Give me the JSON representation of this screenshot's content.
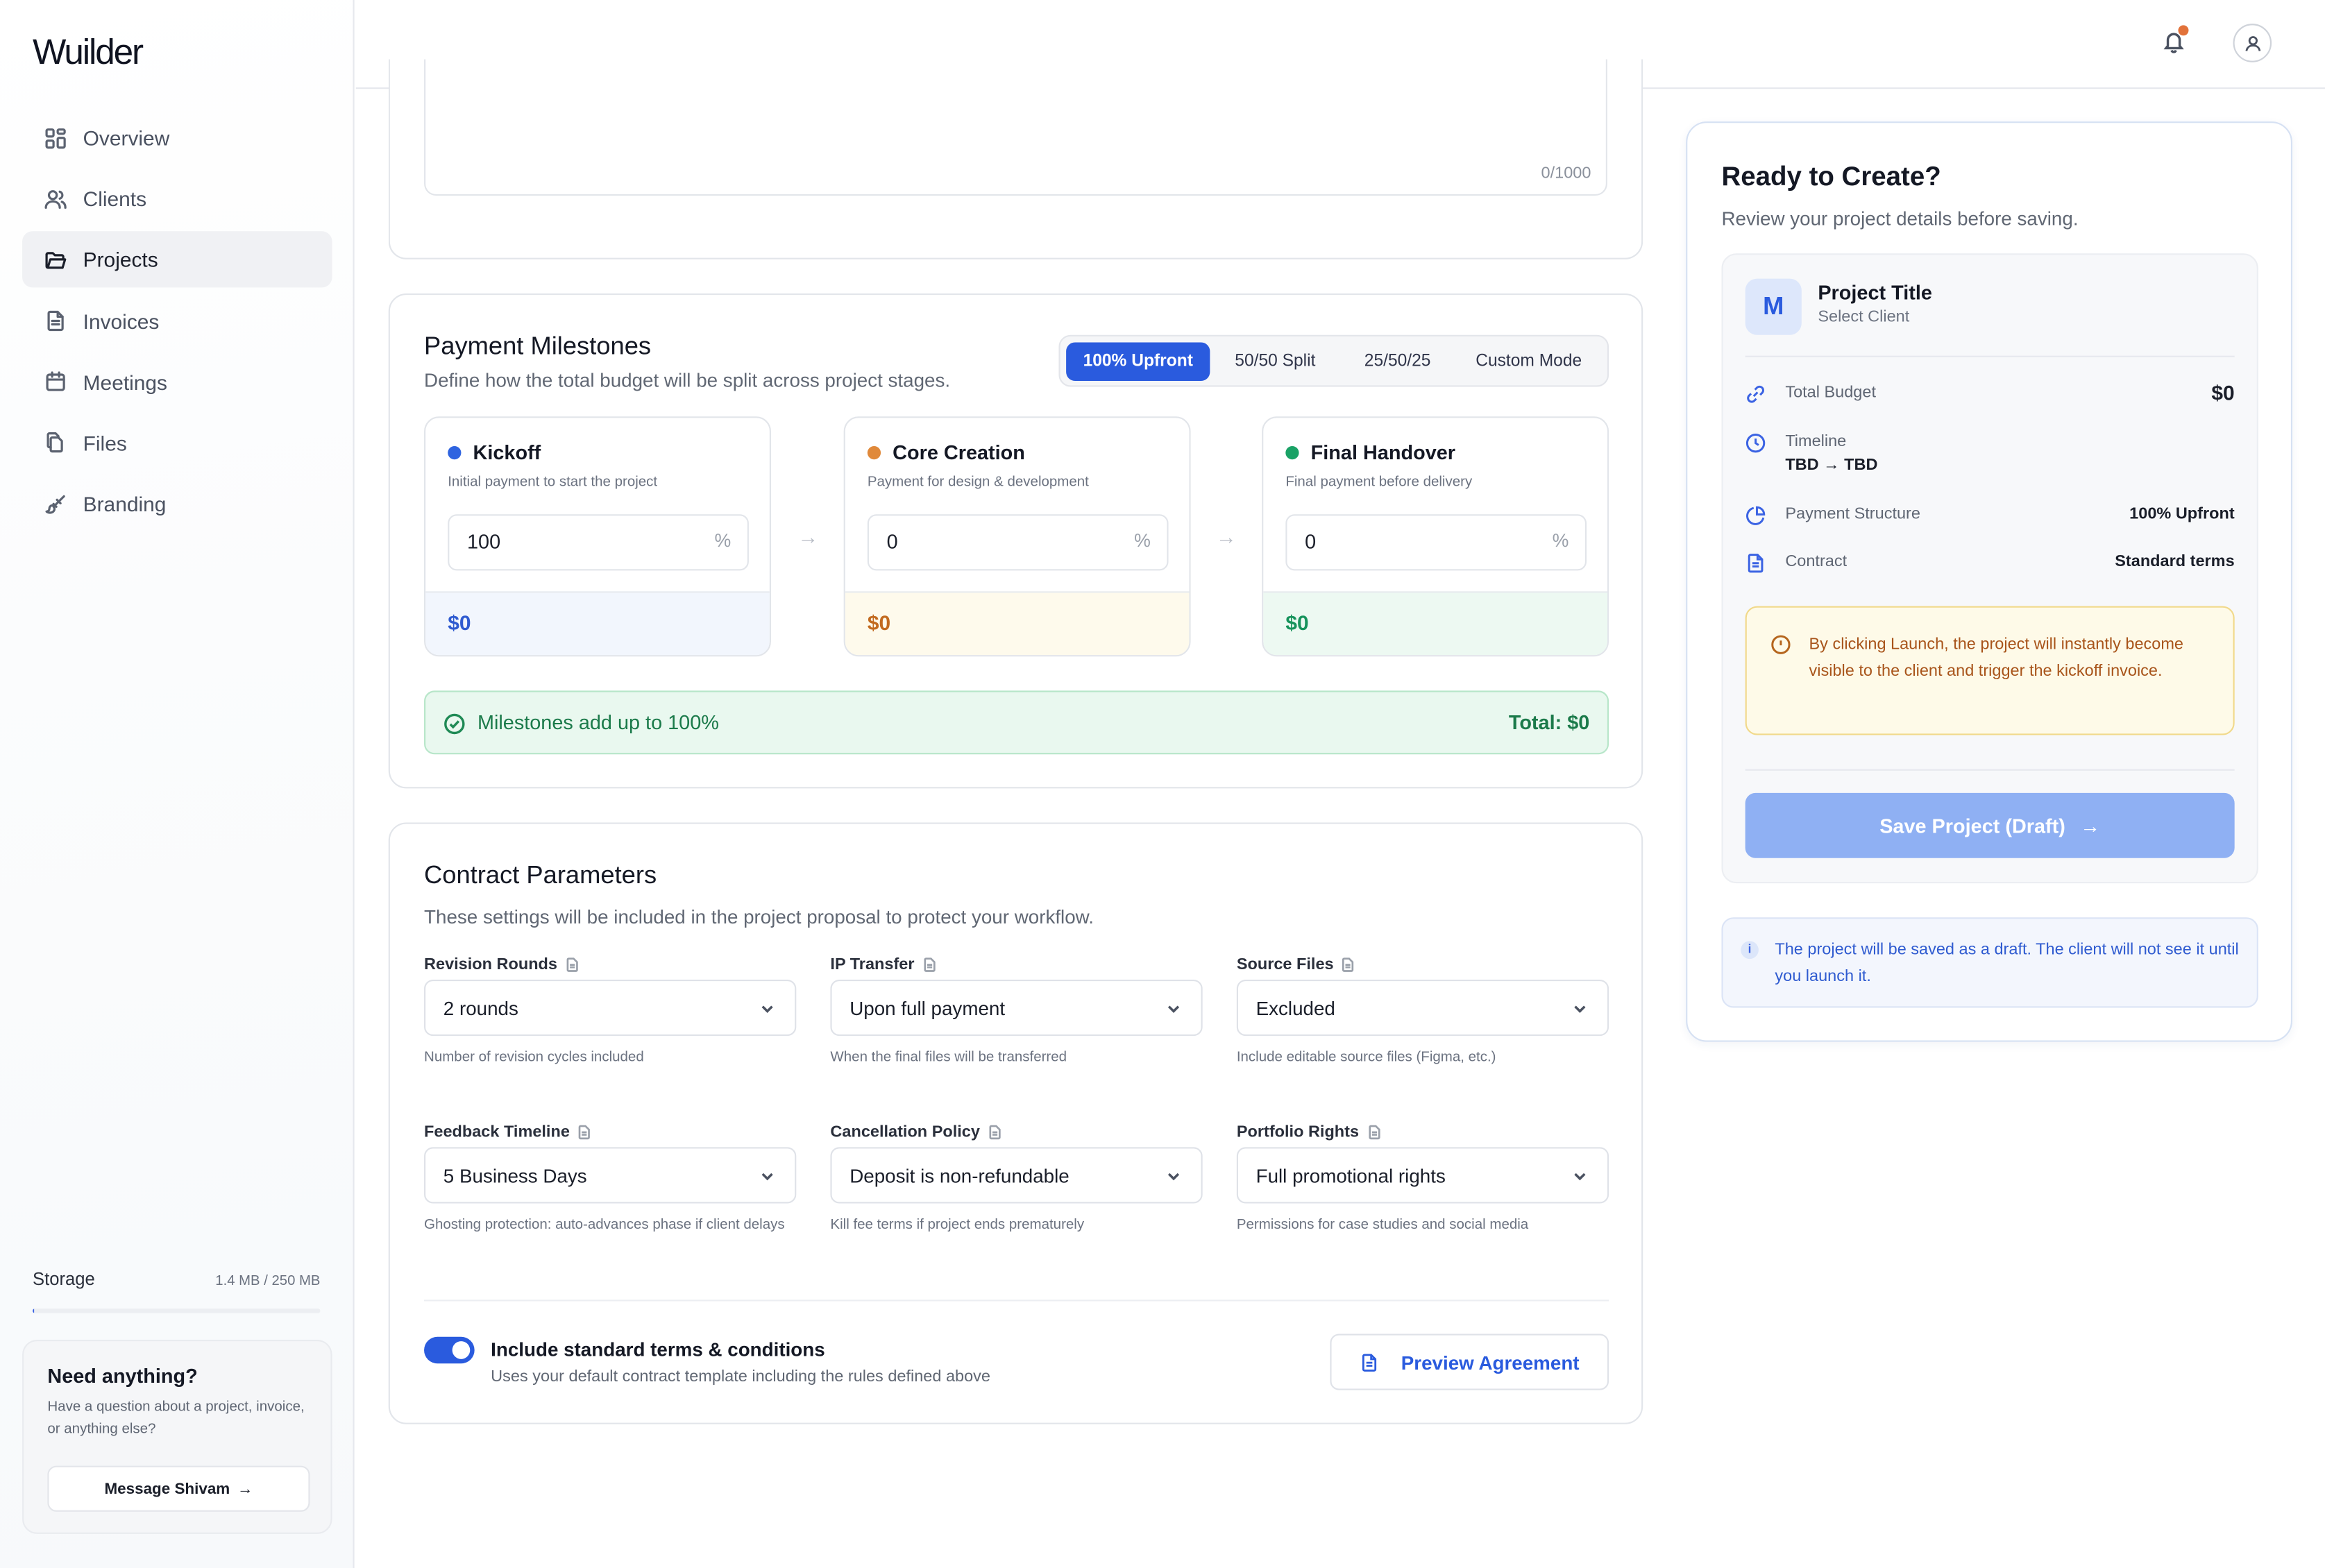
{
  "app": {
    "logo": "Wuilder"
  },
  "sidebar": {
    "items": [
      {
        "label": "Overview",
        "icon": "grid-icon",
        "active": false
      },
      {
        "label": "Clients",
        "icon": "users-icon",
        "active": false
      },
      {
        "label": "Projects",
        "icon": "folder-icon",
        "active": true
      },
      {
        "label": "Invoices",
        "icon": "file-text-icon",
        "active": false
      },
      {
        "label": "Meetings",
        "icon": "calendar-icon",
        "active": false
      },
      {
        "label": "Files",
        "icon": "files-icon",
        "active": false
      },
      {
        "label": "Branding",
        "icon": "brush-icon",
        "active": false
      }
    ],
    "storage": {
      "label": "Storage",
      "value": "1.4 MB / 250 MB",
      "fill_percent": 0.6
    },
    "help": {
      "title": "Need anything?",
      "text": "Have a question about a project, invoice, or anything else?",
      "button": "Message Shivam",
      "button_arrow": "→"
    }
  },
  "description": {
    "counter": "0/1000"
  },
  "payment": {
    "title": "Payment Milestones",
    "subtitle": "Define how the total budget will be split across project stages.",
    "modes": [
      "100% Upfront",
      "50/50 Split",
      "25/50/25",
      "Custom Mode"
    ],
    "active_mode": "100% Upfront",
    "milestones": [
      {
        "title": "Kickoff",
        "subtitle": "Initial payment to start the project",
        "value": "100",
        "unit": "%",
        "amount": "$0",
        "color": "#2f64e0"
      },
      {
        "title": "Core Creation",
        "subtitle": "Payment for design & development",
        "value": "0",
        "unit": "%",
        "amount": "$0",
        "color": "#e0893a"
      },
      {
        "title": "Final Handover",
        "subtitle": "Final payment before delivery",
        "value": "0",
        "unit": "%",
        "amount": "$0",
        "color": "#1aa266"
      }
    ],
    "status": "Milestones add up to 100%",
    "total": "Total: $0"
  },
  "contract": {
    "title": "Contract Parameters",
    "subtitle": "These settings will be included in the project proposal to protect your workflow.",
    "fields": [
      {
        "label": "Revision Rounds",
        "value": "2 rounds",
        "help": "Number of revision cycles included"
      },
      {
        "label": "IP Transfer",
        "value": "Upon full payment",
        "help": "When the final files will be transferred"
      },
      {
        "label": "Source Files",
        "value": "Excluded",
        "help": "Include editable source files (Figma, etc.)"
      },
      {
        "label": "Feedback Timeline",
        "value": "5 Business Days",
        "help": "Ghosting protection: auto-advances phase if client delays"
      },
      {
        "label": "Cancellation Policy",
        "value": "Deposit is non-refundable",
        "help": "Kill fee terms if project ends prematurely"
      },
      {
        "label": "Portfolio Rights",
        "value": "Full promotional rights",
        "help": "Permissions for case studies and social media"
      }
    ],
    "terms_title": "Include standard terms & conditions",
    "terms_sub": "Uses your default contract template including the rules defined above",
    "terms_enabled": true,
    "preview_button": "Preview Agreement"
  },
  "summary": {
    "title": "Ready to Create?",
    "subtitle": "Review your project details before saving.",
    "avatar_letter": "M",
    "project_title": "Project Title",
    "client": "Select Client",
    "rows": {
      "budget_label": "Total Budget",
      "budget_value": "$0",
      "timeline_label": "Timeline",
      "timeline_value": "TBD → TBD",
      "structure_label": "Payment Structure",
      "structure_value": "100% Upfront",
      "contract_label": "Contract",
      "contract_value": "Standard terms"
    },
    "warning": "By clicking Launch, the project will instantly become visible to the client and trigger the kickoff invoice.",
    "save_button": "Save Project (Draft)",
    "save_arrow": "→",
    "info_icon": "i",
    "info": "The project will be saved as a draft. The client will not see it until you launch it."
  }
}
